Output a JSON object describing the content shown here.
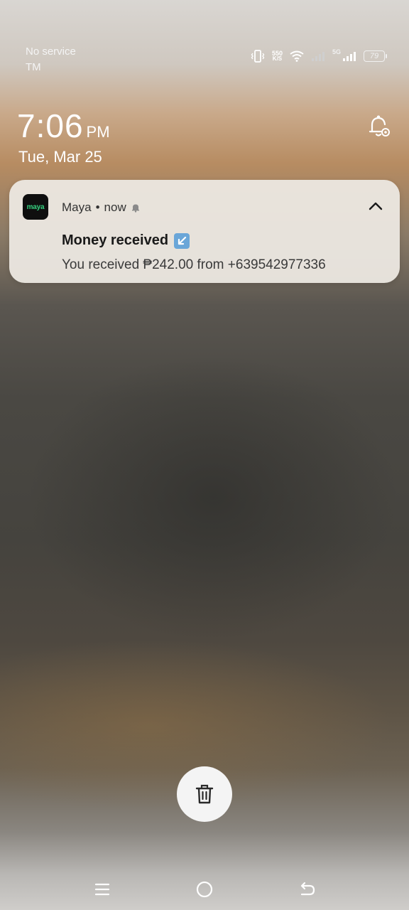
{
  "status_bar": {
    "carrier_line1": "No service",
    "carrier_line2": "TM",
    "network_speed_value": "550",
    "network_speed_unit": "K/S",
    "network_type": "5G",
    "battery_level": "79",
    "icons": [
      "vibrate-icon",
      "wifi-icon",
      "signal-icon",
      "signal-5g-icon",
      "battery-icon"
    ]
  },
  "lockscreen": {
    "time": "7:06",
    "ampm": "PM",
    "date": "Tue, Mar 25"
  },
  "notification": {
    "app_icon_text": "maya",
    "app_name": "Maya",
    "separator": "•",
    "time": "now",
    "title": "Money received",
    "body": "You received ₱242.00 from +639542977336",
    "accent_color": "#35d07f"
  },
  "actions": {
    "clear_all_icon": "trash-icon"
  },
  "nav_bar": {
    "icons": [
      "menu-icon",
      "home-icon",
      "back-icon"
    ]
  }
}
